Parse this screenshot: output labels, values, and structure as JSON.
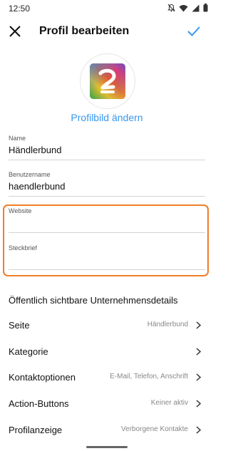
{
  "status_bar": {
    "time": "12:50",
    "icons": [
      "mute-icon",
      "wifi-icon",
      "signal-icon",
      "battery-icon"
    ]
  },
  "header": {
    "title": "Profil bearbeiten",
    "close_icon": "close-icon",
    "confirm_icon": "checkmark-icon",
    "accent_color": "#3897f0"
  },
  "profile": {
    "change_photo_label": "Profilbild ändern"
  },
  "fields": [
    {
      "label": "Name",
      "value": "Händlerbund"
    },
    {
      "label": "Benutzername",
      "value": "haendlerbund"
    },
    {
      "label": "Website",
      "value": ""
    },
    {
      "label": "Steckbrief",
      "value": ""
    }
  ],
  "highlight_color": "#f07d27",
  "business_section": {
    "title": "Öffentlich sichtbare Unternehmensdetails",
    "rows": [
      {
        "label": "Seite",
        "value": "Händlerbund"
      },
      {
        "label": "Kategorie",
        "value": ""
      },
      {
        "label": "Kontaktoptionen",
        "value": "E-Mail, Telefon, Anschrift"
      },
      {
        "label": "Action-Buttons",
        "value": "Keiner aktiv"
      },
      {
        "label": "Profilanzeige",
        "value": "Verborgene Kontakte"
      }
    ]
  }
}
